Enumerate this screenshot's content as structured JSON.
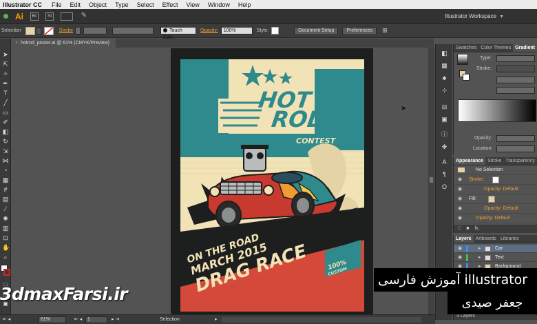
{
  "menubar": {
    "app": "Illustrator CC",
    "items": [
      "File",
      "Edit",
      "Object",
      "Type",
      "Select",
      "Effect",
      "View",
      "Window",
      "Help"
    ]
  },
  "appbar": {
    "logo": "Ai",
    "icons": [
      "Br",
      "St"
    ],
    "workspace": "Illustrator Workspace"
  },
  "controlbar": {
    "selection_label": "Selection",
    "fill_color": "#e8d3a8",
    "stroke_label": "Stroke",
    "brush": "Touch Call...",
    "opacity_label": "Opacity:",
    "opacity_value": "100%",
    "style_label": "Style:",
    "doc_setup_btn": "Document Setup",
    "preferences_btn": "Preferences"
  },
  "document": {
    "tab_title": "hotrod_poster.ai @ 61% (CMYK/Preview)",
    "close_icon": "×"
  },
  "poster": {
    "title_line1": "HOT",
    "title_line2": "ROD",
    "subtitle": "CONTEST",
    "date_line1": "ON THE ROAD",
    "date_line2": "MARCH 2015",
    "event": "DRAG RACE",
    "badge_line1": "100%",
    "badge_line2": "CUSTOM",
    "colors": {
      "cream": "#f2e3b6",
      "teal": "#2e8a8c",
      "navy": "#20435b",
      "red": "#d4493a",
      "black": "#1d1e1e"
    }
  },
  "gradient_panel": {
    "tabs": [
      "Swatches",
      "Color Themes",
      "Gradient"
    ],
    "type_label": "Type:",
    "stroke_label": "Stroke:",
    "opacity_label": "Opacity:",
    "location_label": "Location:"
  },
  "appearance_panel": {
    "tabs": [
      "Appearance",
      "Stroke",
      "Transparency"
    ],
    "header": "No Selection",
    "rows": [
      {
        "label": "Stroke:",
        "orange": true
      },
      {
        "label": "Opacity: Default",
        "orange": true
      },
      {
        "label": "Fill:",
        "orange": false
      },
      {
        "label": "Opacity: Default",
        "orange": true
      },
      {
        "label": "Opacity: Default",
        "orange": true
      }
    ],
    "footer": "fx."
  },
  "layers_panel": {
    "tabs": [
      "Layers",
      "Artboards",
      "Libraries"
    ],
    "layers": [
      {
        "name": "Car",
        "color": "#3d8ef0",
        "selected": true
      },
      {
        "name": "Text",
        "color": "#3ec35a",
        "selected": false
      },
      {
        "name": "Background",
        "color": "#3d8ef0",
        "selected": false
      }
    ],
    "count": "3 Layers"
  },
  "statusbar": {
    "zoom": "61%",
    "artboard": "1",
    "mode": "Selection"
  },
  "watermark": {
    "site": "3dmaxFarsi.ir",
    "course": "آموزش فارسی  illustrator",
    "author": "جعفر صیدی"
  }
}
